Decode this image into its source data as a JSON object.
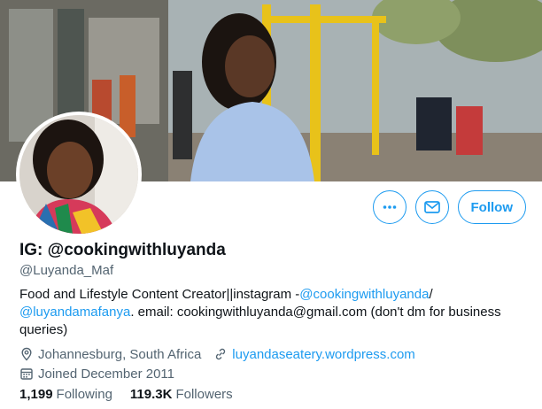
{
  "banner": {
    "alt": ""
  },
  "actions": {
    "more_icon": "more-horizontal-icon",
    "message_icon": "envelope-icon",
    "follow_label": "Follow",
    "accent": "#1d9bf0"
  },
  "profile": {
    "display_name": "IG: @cookingwithluyanda",
    "handle": "@Luyanda_Maf"
  },
  "bio": {
    "text_1": "Food and Lifestyle Content Creator||instagram -",
    "link_1": "@cookingwithluyanda",
    "text_2": "/ ",
    "link_2": "@luyandamafanya",
    "text_3": ". email: cookingwithluyanda@gmail.com (don't dm for business queries)"
  },
  "meta": {
    "location": "Johannesburg, South Africa",
    "website": "luyandaseatery.wordpress.com",
    "joined": "Joined December 2011"
  },
  "stats": {
    "following_count": "1,199",
    "following_label": "Following",
    "followers_count": "119.3K",
    "followers_label": "Followers"
  }
}
